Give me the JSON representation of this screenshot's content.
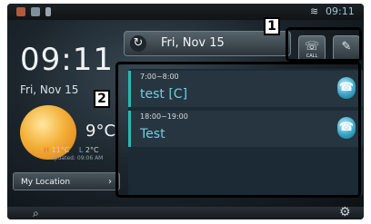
{
  "status_bar": {
    "time": "09:11"
  },
  "clock": {
    "time": "09:11",
    "date": "Fri, Nov 15"
  },
  "weather": {
    "temp": "9°C",
    "high": "11°C",
    "high_label": "H",
    "low": "2°C",
    "low_label": "L",
    "updated": "updated: 09:06 AM"
  },
  "location_button": {
    "label": "My Location",
    "chevron": "›"
  },
  "date_header": {
    "date": "Fri, Nov 15",
    "refresh_icon": "↻"
  },
  "header_buttons": [
    {
      "icon": "phone-all-icon",
      "glyph": "☏",
      "sub": "CALL"
    },
    {
      "icon": "edit-icon",
      "glyph": "✎"
    }
  ],
  "annotations": {
    "label1": "1",
    "label2": "2"
  },
  "events": [
    {
      "time": "7:00~8:00",
      "title": "test [C]",
      "icon": "phone-icon"
    },
    {
      "time": "18:00~19:00",
      "title": "Test",
      "icon": "phone-icon"
    }
  ],
  "bottom_bar": {
    "left_icon": "search-icon",
    "right_icon": "gear-icon"
  },
  "colors": {
    "accent": "#2bb8b4",
    "event_title": "#6fd0e0"
  }
}
